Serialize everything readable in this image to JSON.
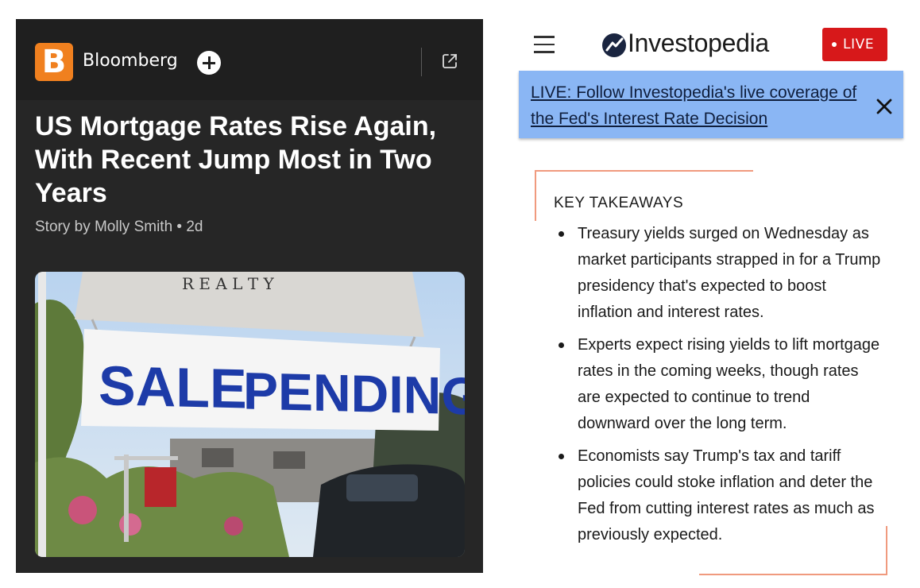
{
  "left_panel": {
    "publisher": {
      "logo_letter": "B",
      "name": "Bloomberg",
      "icon": "b-logo-icon",
      "accent": "#f0801f"
    },
    "actions": {
      "follow_icon": "plus-icon",
      "open_icon": "external-link-icon"
    },
    "article": {
      "headline": "US Mortgage Rates Rise Again, With Recent Jump Most in Two Years",
      "byline": "Story by Molly Smith • 2d"
    },
    "photo": {
      "top_sign_text": "R E A L T Y",
      "sign_left": "SALE",
      "sign_right": "PENDING",
      "sign_color": "#1d3ba8"
    }
  },
  "right_panel": {
    "header": {
      "menu_icon": "hamburger-icon",
      "logo_icon": "investopedia-logo-icon",
      "site_name": "Investopedia",
      "live_label": "LIVE",
      "live_color": "#d7181a"
    },
    "banner": {
      "text": "LIVE: Follow Investopedia's live coverage of the Fed's Interest Rate Decision",
      "close_icon": "close-icon",
      "bg": "#8ab6f4"
    },
    "takeaways": {
      "title": "KEY TAKEAWAYS",
      "items": [
        "Treasury yields surged on Wednesday as market participants strapped in for a Trump presidency that's expected to boost inflation and interest rates.",
        "Experts expect rising yields to lift mortgage rates in the coming weeks, though rates are expected to continue to trend downward over the long term.",
        "Economists say Trump's tax and tariff policies could stoke inflation and deter the Fed from cutting interest rates as much as previously expected."
      ],
      "frame_color": "#f09a7e"
    }
  }
}
